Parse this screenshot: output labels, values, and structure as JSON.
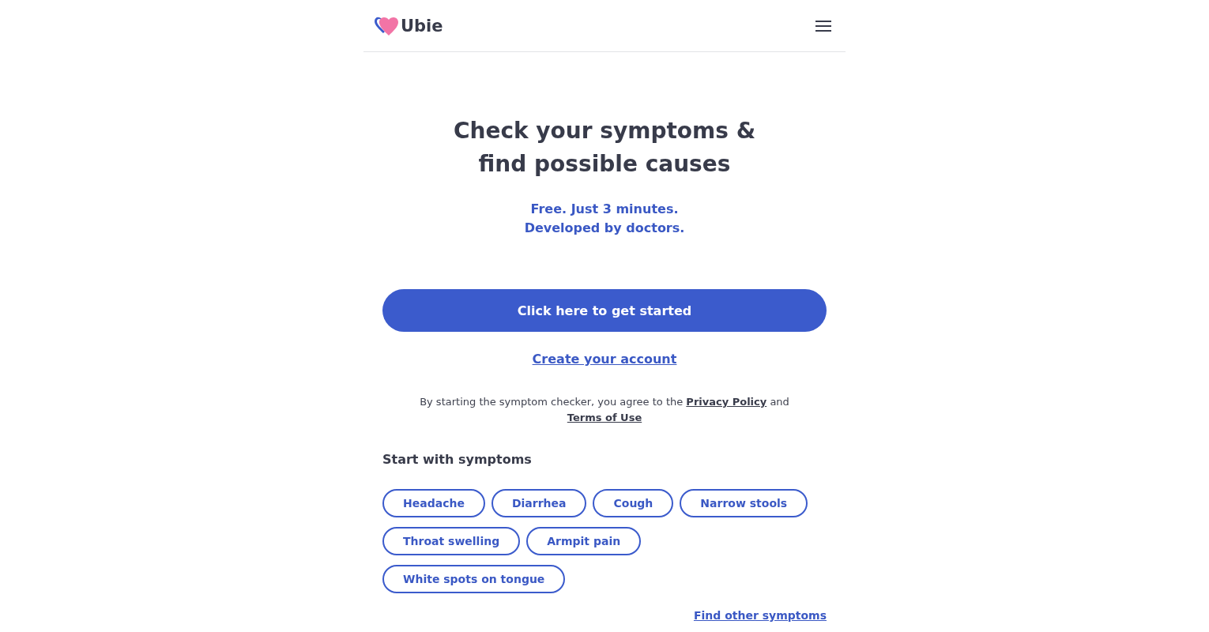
{
  "header": {
    "logo_text": "Ubie"
  },
  "hero": {
    "title_lines": [
      "Check your symptoms &",
      "find possible causes"
    ],
    "subtitle_lines": [
      "Free. Just 3 minutes.",
      "Developed by doctors."
    ]
  },
  "cta_button": "Click here to get started",
  "account_link": "Create your account",
  "consent": {
    "text_before": "By starting the symptom checker, you agree to the",
    "privacy_link": "Privacy Policy",
    "text_between": "and",
    "terms_link": "Terms of Use"
  },
  "symptoms": {
    "heading": "Start with symptoms",
    "chips": [
      "Headache",
      "Diarrhea",
      "Cough",
      "Narrow stools",
      "Throat swelling",
      "Armpit pain",
      "White spots on tongue"
    ],
    "more_link": "Find other symptoms"
  }
}
